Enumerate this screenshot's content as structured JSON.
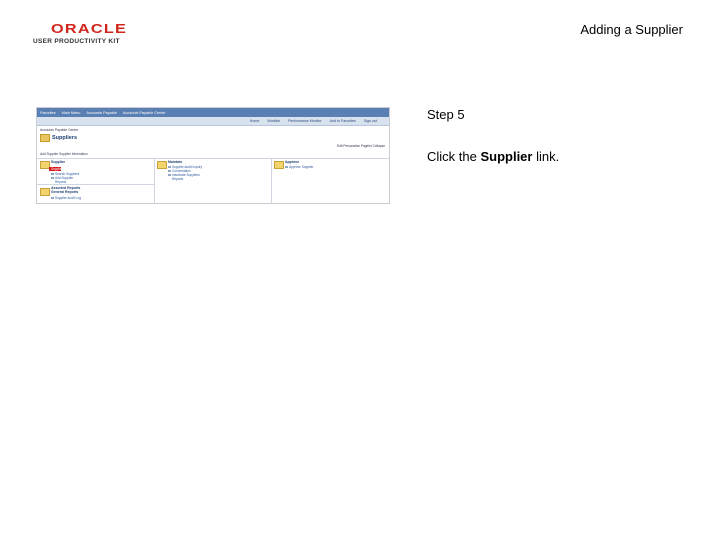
{
  "header": {
    "logo_oracle": "ORACLE",
    "logo_upk": "USER PRODUCTIVITY KIT",
    "doc_title": "Adding a Supplier"
  },
  "step": {
    "label": "Step 5",
    "instruction_prefix": "Click the ",
    "instruction_bold": "Supplier",
    "instruction_suffix": " link."
  },
  "screenshot": {
    "nav1": [
      "Favorites",
      "Main Menu",
      "Accounts Payable",
      "Accounts Payable Center"
    ],
    "nav2": [
      "Home",
      "Worklist",
      "Performance Monitor",
      "Add to Favorites",
      "Sign out"
    ],
    "breadcrumb": "Accounts Payable Center",
    "page_title": "Suppliers",
    "personal_link": "Edit Personalize Pagelet  Collapse",
    "subheader": "Add Supplier  Supplier Information",
    "groups": [
      {
        "title": "Supplier",
        "links": [
          "Supplier",
          "Search Suppliers",
          "Add Supplier",
          "Reports"
        ]
      },
      {
        "title": "Maintain",
        "links": [
          "Supplier Audit Inquiry",
          "Conversation",
          "Inactivate Suppliers",
          "Reports"
        ]
      },
      {
        "title": "Approve",
        "links": [
          "Approve Supplier"
        ]
      },
      {
        "title": "Assorted Reports General Reports",
        "links": [
          "Supplier Audit Log"
        ]
      }
    ]
  }
}
